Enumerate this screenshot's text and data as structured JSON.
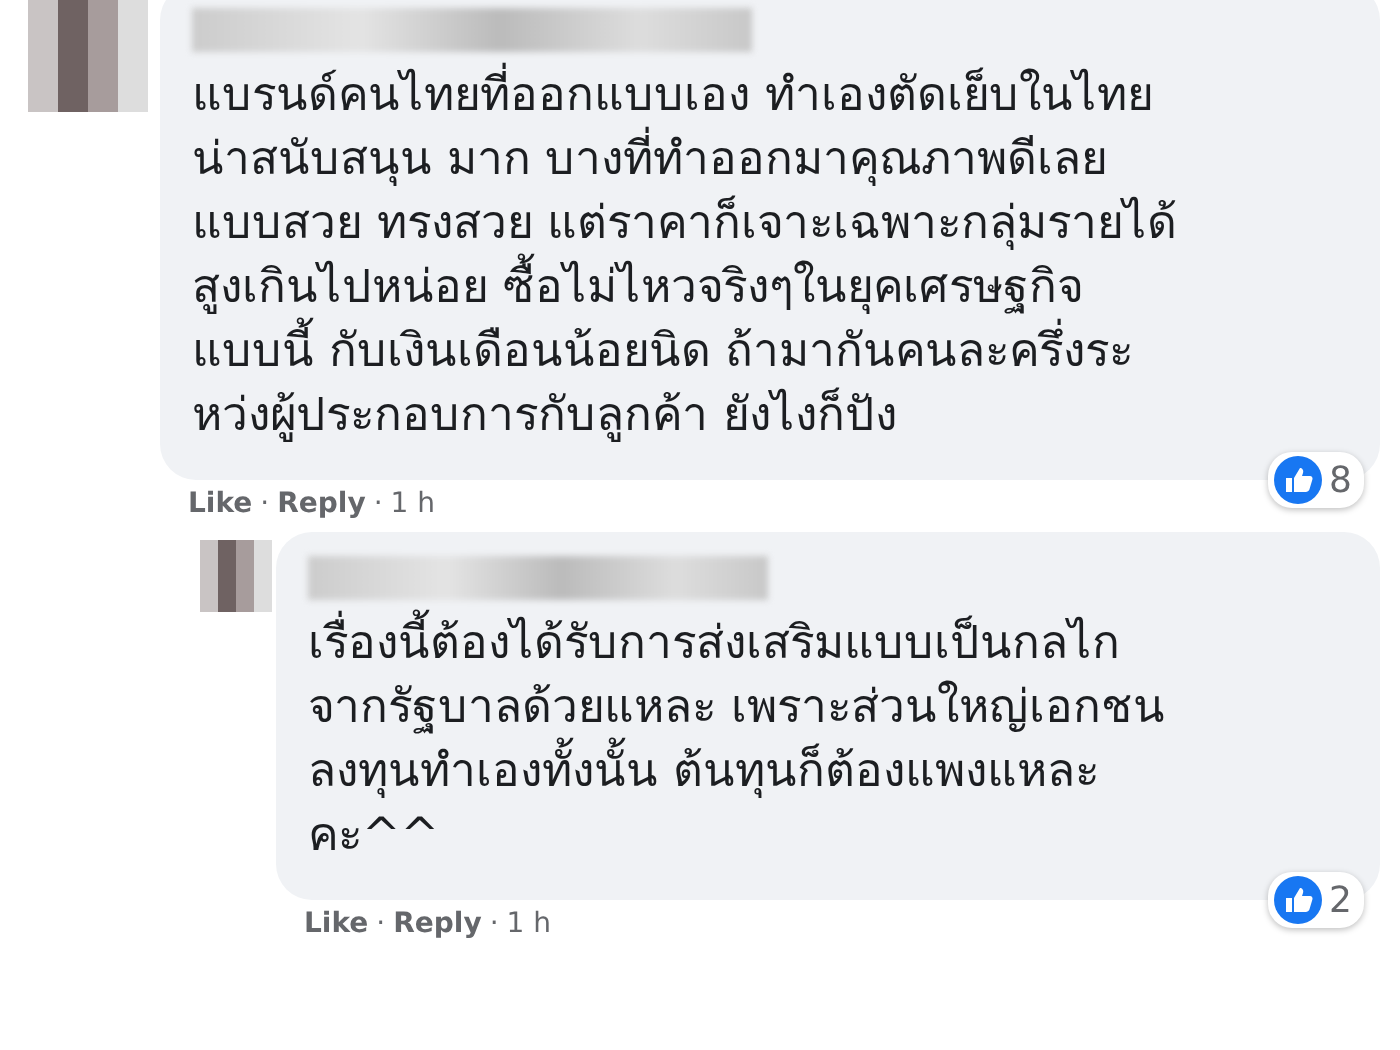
{
  "comments": [
    {
      "text": "แบรนด์คนไทยที่ออกแบบเอง ทำเองตัดเย็บในไทย\nน่าสนับสนุน มาก บางที่ทำออกมาคุณภาพดีเลย\nแบบสวย ทรงสวย แต่ราคาก็เจาะเฉพาะกลุ่มรายได้\nสูงเกินไปหน่อย ซื้อไม่ไหวจริงๆในยุคเศรษฐกิจ\nแบบนี้ กับเงินเดือนน้อยนิด ถ้ามากันคนละครึ่งระ\nหว่งผู้ประกอบการกับลูกค้า ยังไงก็ปัง",
      "actions": [
        "Like",
        "Reply"
      ],
      "separator": "·",
      "time": "1 h",
      "reaction_count": "8",
      "replies": [
        {
          "text": "เรื่องนี้ต้องได้รับการส่งเสริมแบบเป็นกลไก\nจากรัฐบาลด้วยแหละ เพราะส่วนใหญ่เอกชน\nลงทุนทำเองทั้งนั้น ต้นทุนก็ต้องแพงแหละ\nคะ^^",
          "actions": [
            "Like",
            "Reply"
          ],
          "separator": "·",
          "time": "1 h",
          "reaction_count": "2"
        }
      ]
    }
  ]
}
